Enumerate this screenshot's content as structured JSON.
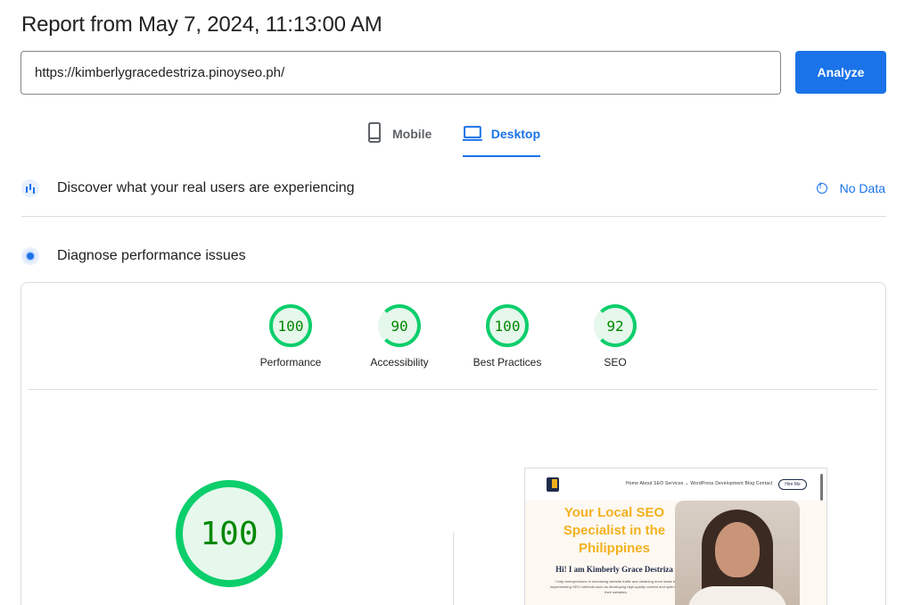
{
  "header": {
    "title": "Report from May 7, 2024, 11:13:00 AM"
  },
  "search": {
    "url": "https://kimberlygracedestriza.pinoyseo.ph/",
    "analyze_label": "Analyze"
  },
  "tabs": [
    {
      "label": "Mobile",
      "icon": "smartphone-icon",
      "active": false
    },
    {
      "label": "Desktop",
      "icon": "laptop-icon",
      "active": true
    }
  ],
  "field_data": {
    "title": "Discover what your real users are experiencing",
    "no_data_label": "No Data"
  },
  "lab_data": {
    "title": "Diagnose performance issues"
  },
  "scores": [
    {
      "label": "Performance",
      "value": "100"
    },
    {
      "label": "Accessibility",
      "value": "90"
    },
    {
      "label": "Best Practices",
      "value": "100"
    },
    {
      "label": "SEO",
      "value": "92"
    }
  ],
  "main_score": {
    "value": "100"
  },
  "preview": {
    "nav_links": "Home    About    SEO Services ⌄    WordPress Development    Blog    Contact",
    "hire_label": "Hire Me",
    "headline": "Your Local SEO Specialist in the Philippines",
    "subheadline": "Hi! I am Kimberly Grace Destriza",
    "body": "I help entrepreneurs in increasing website traffic and obtaining more leads by implementing SEO methods such as developing high-quality content and optimizing their websites."
  },
  "colors": {
    "accent": "#1a73e8",
    "pass": "#0cce6b",
    "pass_text": "#008800",
    "pass_bg": "#e6f7ec"
  }
}
